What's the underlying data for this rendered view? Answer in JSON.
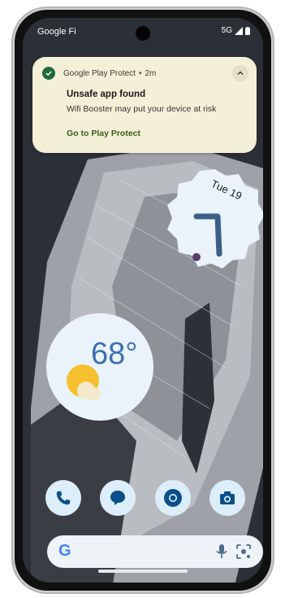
{
  "status_bar": {
    "carrier": "Google Fi",
    "network": "5G"
  },
  "notification": {
    "app_name": "Google Play Protect",
    "separator": "•",
    "time": "2m",
    "title": "Unsafe app found",
    "body": "Wifi Booster may put your device at risk",
    "action": "Go to Play Protect",
    "icon": "shield-check-icon"
  },
  "clock_widget": {
    "date": "Tue 19"
  },
  "weather_widget": {
    "temperature": "68°",
    "icon": "sun-cloud-icon"
  },
  "dock": [
    {
      "name": "phone-app",
      "icon": "phone-icon"
    },
    {
      "name": "messages-app",
      "icon": "chat-icon"
    },
    {
      "name": "chrome-app",
      "icon": "chrome-icon"
    },
    {
      "name": "camera-app",
      "icon": "camera-icon"
    }
  ],
  "search_bar": {
    "logo": "G",
    "icons": [
      "mic-icon",
      "lens-icon"
    ]
  },
  "colors": {
    "notification_bg": "#f4f0d8",
    "accent_green": "#1e6b3a",
    "weather_blue": "#3d6fb0",
    "clock_hand": "#3b5f86"
  }
}
